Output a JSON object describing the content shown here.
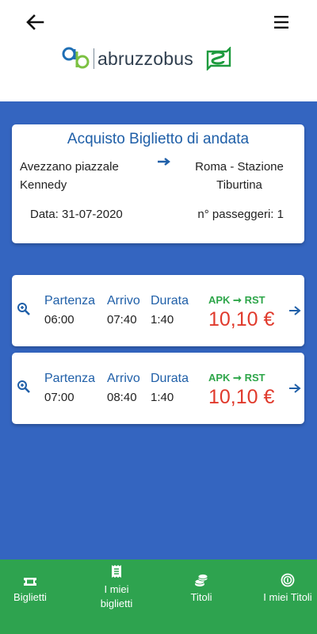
{
  "header": {
    "logo_text": "abruzzobus"
  },
  "summary": {
    "title": "Acquisto Biglietto di andata",
    "from": "Avezzano piazzale Kennedy",
    "to": "Roma - Stazione Tiburtina",
    "date": "Data: 31-07-2020",
    "passengers": "n° passeggeri: 1"
  },
  "column_headers": {
    "departure": "Partenza",
    "arrival": "Arrivo",
    "duration": "Durata"
  },
  "trips": [
    {
      "departure": "06:00",
      "arrival": "07:40",
      "duration": "1:40",
      "route_codes": "APK ➞ RST",
      "price": "10,10 €"
    },
    {
      "departure": "07:00",
      "arrival": "08:40",
      "duration": "1:40",
      "route_codes": "APK ➞ RST",
      "price": "10,10 €"
    }
  ],
  "bottom_nav": {
    "items": [
      {
        "label": "Biglietti",
        "icon": "ticket-icon"
      },
      {
        "label": "I miei biglietti",
        "icon": "receipt-icon"
      },
      {
        "label": "Titoli",
        "icon": "coins-icon"
      },
      {
        "label": "I miei Titoli",
        "icon": "copyright-circle-icon"
      }
    ]
  },
  "colors": {
    "primary_blue": "#3465c0",
    "title_blue": "#1f5fa8",
    "green": "#2ea34f",
    "price_red": "#e03a2c"
  }
}
